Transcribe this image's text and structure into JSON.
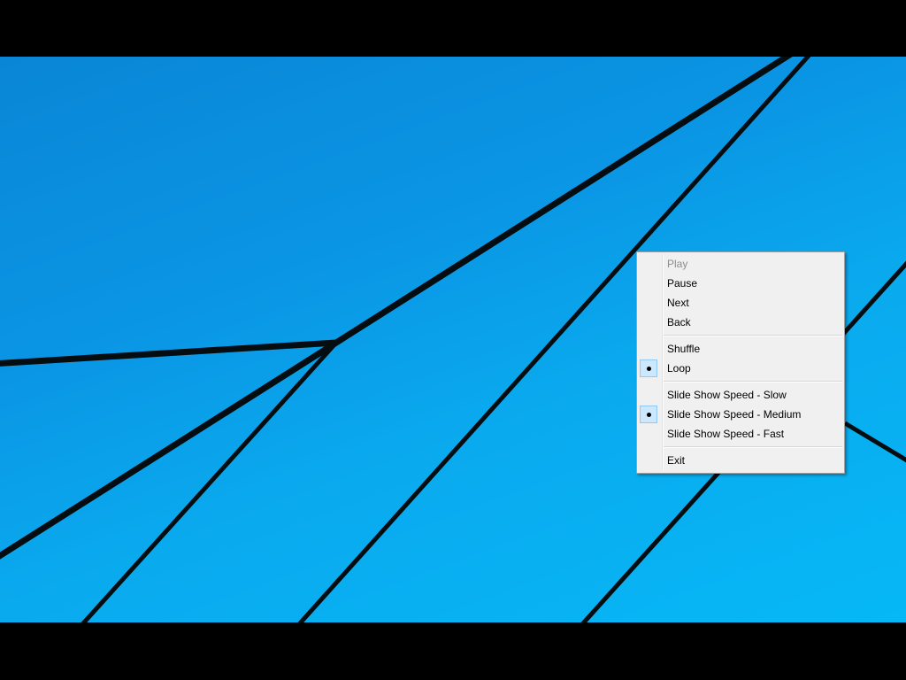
{
  "menu": {
    "items": [
      {
        "label": "Play",
        "enabled": false,
        "checked": false
      },
      {
        "label": "Pause",
        "enabled": true,
        "checked": false
      },
      {
        "label": "Next",
        "enabled": true,
        "checked": false
      },
      {
        "label": "Back",
        "enabled": true,
        "checked": false
      },
      {
        "label": "Shuffle",
        "enabled": true,
        "checked": false
      },
      {
        "label": "Loop",
        "enabled": true,
        "checked": true
      },
      {
        "label": "Slide Show Speed - Slow",
        "enabled": true,
        "checked": false
      },
      {
        "label": "Slide Show Speed - Medium",
        "enabled": true,
        "checked": true
      },
      {
        "label": "Slide Show Speed - Fast",
        "enabled": true,
        "checked": false
      },
      {
        "label": "Exit",
        "enabled": true,
        "checked": false
      }
    ]
  },
  "colors": {
    "wallpaper": "#0a9ae6",
    "menu_background": "#f0f0f0",
    "checked_highlight": "#cce8ff"
  }
}
